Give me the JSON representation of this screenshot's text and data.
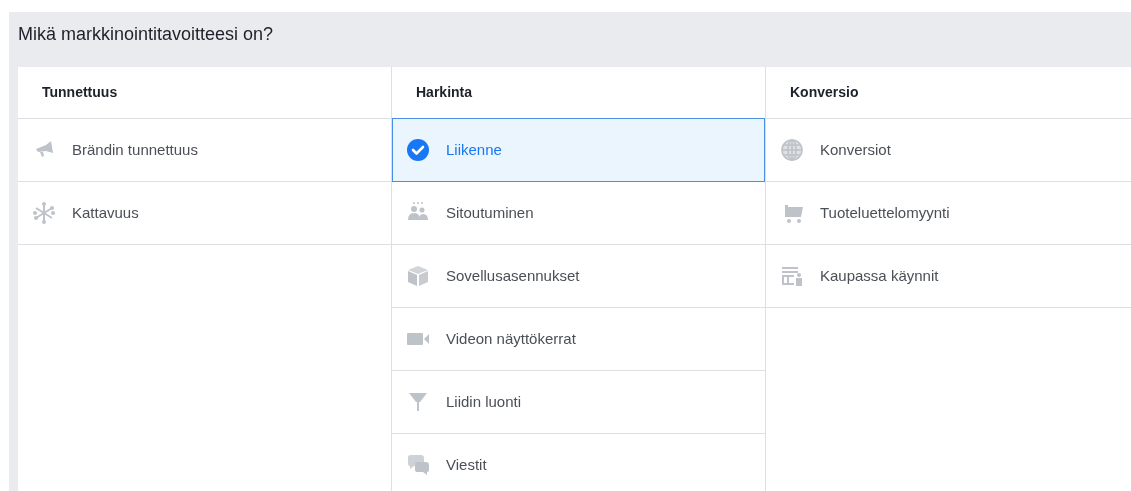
{
  "title": "Mikä markkinointitavoitteesi on?",
  "columns": [
    {
      "heading": "Tunnettuus",
      "items": [
        {
          "label": "Brändin tunnettuus",
          "kind": "megaphone",
          "selected": false
        },
        {
          "label": "Kattavuus",
          "kind": "network",
          "selected": false
        }
      ]
    },
    {
      "heading": "Harkinta",
      "items": [
        {
          "label": "Liikenne",
          "kind": "cursor",
          "selected": true
        },
        {
          "label": "Sitoutuminen",
          "kind": "people",
          "selected": false
        },
        {
          "label": "Sovellusasennukset",
          "kind": "cube",
          "selected": false
        },
        {
          "label": "Videon näyttökerrat",
          "kind": "video",
          "selected": false
        },
        {
          "label": "Liidin luonti",
          "kind": "funnel",
          "selected": false
        },
        {
          "label": "Viestit",
          "kind": "chat",
          "selected": false
        }
      ]
    },
    {
      "heading": "Konversio",
      "items": [
        {
          "label": "Konversiot",
          "kind": "globe",
          "selected": false
        },
        {
          "label": "Tuoteluettelomyynti",
          "kind": "cart",
          "selected": false
        },
        {
          "label": "Kaupassa käynnit",
          "kind": "store",
          "selected": false
        }
      ]
    }
  ]
}
